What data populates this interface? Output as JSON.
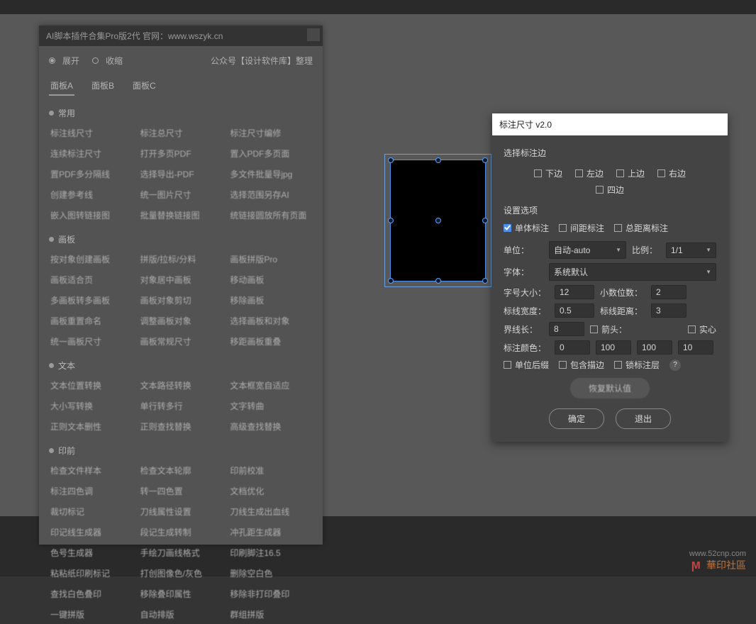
{
  "left_panel": {
    "title": "AI脚本插件合集Pro版2代 官网：www.wszyk.cn",
    "mode": {
      "expand": "展开",
      "collapse": "收缩",
      "credit": "公众号【设计软件库】整理"
    },
    "tabs": [
      "面板A",
      "面板B",
      "面板C"
    ],
    "sections": [
      {
        "title": "常用",
        "items": [
          "标注线尺寸",
          "标注总尺寸",
          "标注尺寸编修",
          "连续标注尺寸",
          "打开多页PDF",
          "置入PDF多页面",
          "置PDF多分隔线",
          "选择导出-PDF",
          "多文件批量导jpg",
          "创建参考线",
          "统一图片尺寸",
          "选择范围另存AI",
          "嵌入图转链接图",
          "批量替换链接图",
          "统链接圆放所有页面"
        ]
      },
      {
        "title": "画板",
        "items": [
          "按对象创建画板",
          "拼版/拉标/分料",
          "画板拼版Pro",
          "画板适合页",
          "对象居中画板",
          "移动画板",
          "多画板转多画板",
          "画板对象剪切",
          "移除画板",
          "画板重置命名",
          "调整画板对象",
          "选择画板和对象",
          "统一画板尺寸",
          "画板常规尺寸",
          "移距画板重叠"
        ]
      },
      {
        "title": "文本",
        "items": [
          "文本位置转换",
          "文本路径转换",
          "文本框宽自适应",
          "大小写转换",
          "单行转多行",
          "文字转曲",
          "正则文本删性",
          "正则查找替换",
          "高级查找替换"
        ]
      },
      {
        "title": "印前",
        "items": [
          "检查文件样本",
          "检查文本轮廓",
          "印前校准",
          "标注四色调",
          "转一四色置",
          "文档优化",
          "裁切标记",
          "刀线属性设置",
          "刀线生成出血线",
          "印记线生成器",
          "段记生成转制",
          "冲孔距生成器",
          "色号生成器",
          "手绘刀画线格式",
          "印刷脚注16.5",
          "粘粘纸印刷标记",
          "打创图像色/灰色",
          "删除空白色",
          "查找白色叠印",
          "移除叠印属性",
          "移除非打印叠印",
          "一键拼版",
          "自动排版",
          "群组拼版"
        ]
      }
    ]
  },
  "dialog": {
    "title": "标注尺寸 v2.0",
    "sel_side_label": "选择标注边",
    "sides": [
      "下边",
      "左边",
      "上边",
      "右边"
    ],
    "all_sides": "四边",
    "options_label": "设置选项",
    "mark_types": {
      "single": "单体标注",
      "gap": "间距标注",
      "total": "总距离标注"
    },
    "unit_label": "单位：",
    "unit_value": "自动-auto",
    "ratio_label": "比例：",
    "ratio_value": "1/1",
    "font_label": "字体：",
    "font_value": "系统默认",
    "fsize_label": "字号大小：",
    "fsize_value": "12",
    "dec_label": "小数位数：",
    "dec_value": "2",
    "lwidth_label": "标线宽度：",
    "lwidth_value": "0.5",
    "ldist_label": "标线距离：",
    "ldist_value": "3",
    "extlen_label": "界线长：",
    "extlen_value": "8",
    "arrow_label": "箭头：",
    "solid_label": "实心",
    "color_label": "标注颜色：",
    "color": [
      "0",
      "100",
      "100",
      "10"
    ],
    "suffix": "单位后缀",
    "stroke": "包含描边",
    "lock": "锁标注层",
    "restore": "恢复默认值",
    "ok": "确定",
    "cancel": "退出"
  },
  "watermark": {
    "url": "www.52cnp.com",
    "text": "華印社區"
  }
}
